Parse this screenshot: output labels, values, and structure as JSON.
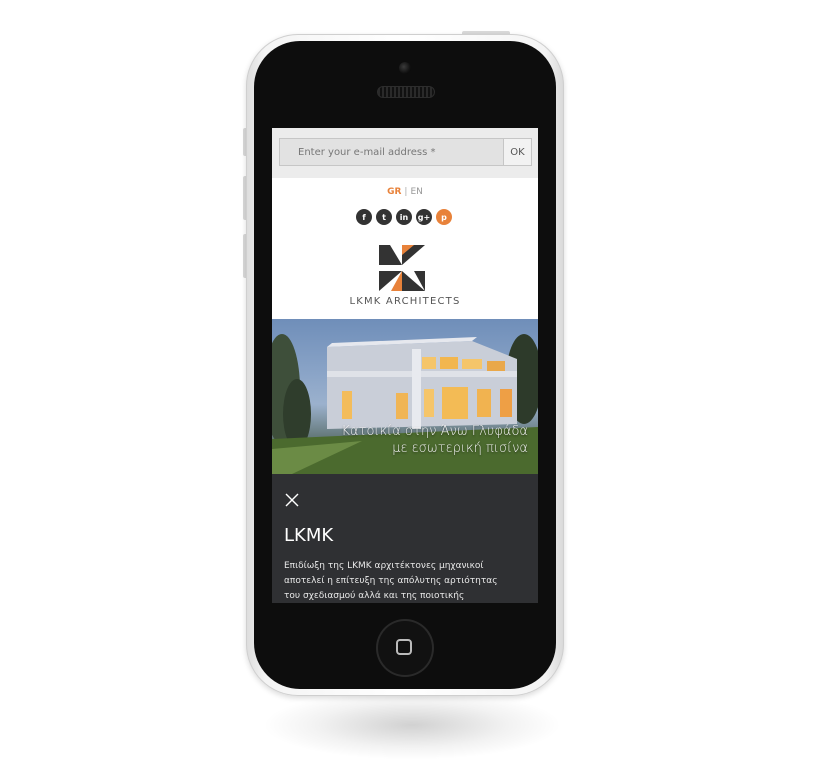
{
  "newsletter": {
    "placeholder": "Enter your e-mail address *",
    "ok_label": "OK"
  },
  "language": {
    "active": "GR",
    "separator": "|",
    "inactive": "EN"
  },
  "social": [
    {
      "icon": "facebook-icon",
      "glyph": "f"
    },
    {
      "icon": "twitter-icon",
      "glyph": "t"
    },
    {
      "icon": "linkedin-icon",
      "glyph": "in"
    },
    {
      "icon": "google-plus-icon",
      "glyph": "g+"
    },
    {
      "icon": "pinterest-icon",
      "glyph": "p"
    }
  ],
  "brand": {
    "name": "LKMK ARCHITECTS"
  },
  "hero": {
    "caption_line1": "Κατοικία στην Άνω Γλυφάδα",
    "caption_line2": "με εσωτερική πισίνα"
  },
  "panel": {
    "title": "LKMK",
    "text_line1": "Επιδίωξη της LKMK αρχιτέκτονες μηχανικοί",
    "text_line2": "αποτελεί η επίτευξη της απόλυτης αρτιότητας",
    "text_line3": "του σχεδιασμού αλλά και της ποιοτικής"
  },
  "colors": {
    "accent": "#e8823a",
    "panel_bg": "#2f3033",
    "dark": "#333333"
  }
}
